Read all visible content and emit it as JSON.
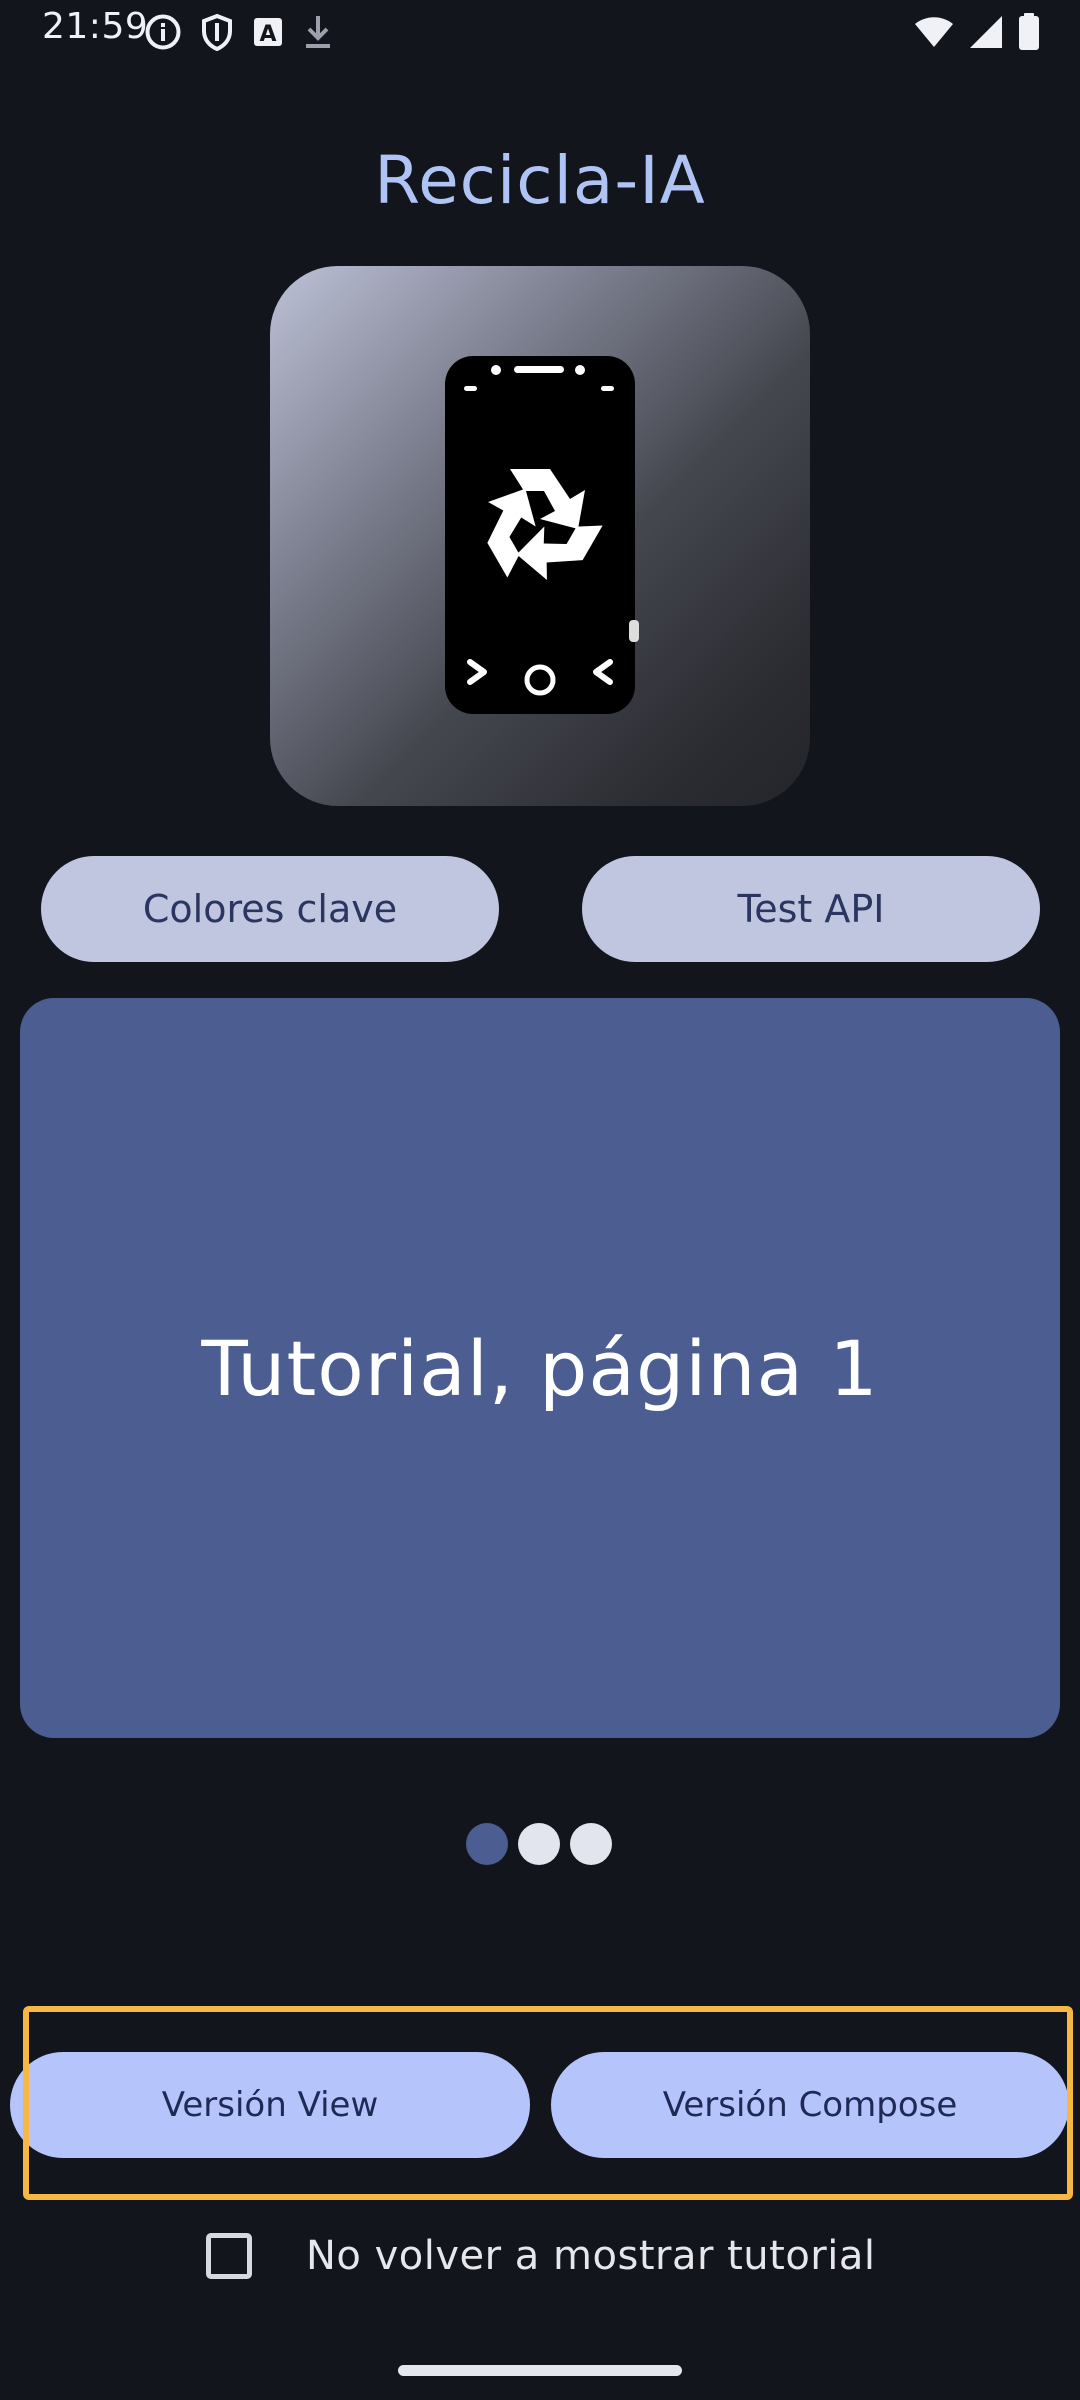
{
  "status_bar": {
    "time": "21:59",
    "left_icons": [
      "info-icon",
      "shield-icon",
      "text-a-icon",
      "download-icon"
    ],
    "right_icons": [
      "wifi-icon",
      "signal-icon",
      "battery-icon"
    ]
  },
  "app": {
    "title": "Recicla-IA",
    "logo_icon": "phone-recycle-logo-icon"
  },
  "top_buttons": {
    "colores_label": "Colores clave",
    "test_label": "Test API"
  },
  "tutorial": {
    "page_text": "Tutorial, página 1",
    "page_count": 3,
    "current_page": 1
  },
  "bottom_buttons": {
    "view_label": "Versión View",
    "compose_label": "Versión Compose"
  },
  "checkbox": {
    "label": "No volver a mostrar tutorial",
    "checked": false
  },
  "colors": {
    "background": "#13151c",
    "title": "#b0c3f5",
    "pager": "#4b5d91",
    "top_pill": "#c0c6df",
    "bottom_pill": "#b5c5fb",
    "highlight": "#f7b843"
  }
}
